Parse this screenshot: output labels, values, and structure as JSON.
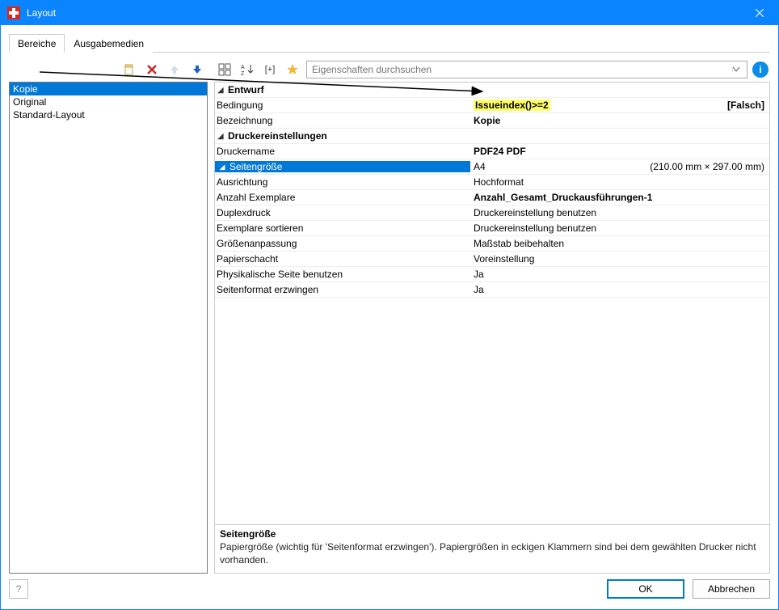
{
  "window": {
    "title": "Layout",
    "close_label": "×"
  },
  "tabs": [
    {
      "id": "bereiche",
      "label": "Bereiche",
      "active": true
    },
    {
      "id": "ausgabemedien",
      "label": "Ausgabemedien",
      "active": false
    }
  ],
  "left_toolbar": {
    "new_icon": "new",
    "delete_icon": "delete",
    "up_icon": "up",
    "down_icon": "down"
  },
  "regions": [
    {
      "label": "Kopie",
      "selected": true
    },
    {
      "label": "Original",
      "selected": false
    },
    {
      "label": "Standard-Layout",
      "selected": false
    }
  ],
  "prop_toolbar": {
    "categorized_icon": "categorized",
    "sort_icon": "sort-az",
    "expand_icon": "[+]",
    "fav_icon": "star",
    "search_placeholder": "Eigenschaften durchsuchen",
    "info_icon": "i"
  },
  "property_groups": [
    {
      "label": "Entwurf",
      "rows": [
        {
          "name": "Bedingung",
          "value": "Issueindex()>=2",
          "highlight": true,
          "extra": "[Falsch]"
        },
        {
          "name": "Bezeichnung",
          "value": "Kopie",
          "bold": true
        }
      ]
    },
    {
      "label": "Druckereinstellungen",
      "rows": [
        {
          "name": "Druckername",
          "value": "PDF24 PDF",
          "bold": true
        },
        {
          "name": "Seitengröße",
          "value": "A4",
          "extra": "(210.00 mm × 297.00 mm)",
          "selected": true,
          "expandable": true,
          "children": [
            {
              "name": "Ausrichtung",
              "value": "Hochformat"
            }
          ]
        },
        {
          "name": "Anzahl Exemplare",
          "value": "Anzahl_Gesamt_Druckausführungen-1",
          "bold": true
        },
        {
          "name": "Duplexdruck",
          "value": "Druckereinstellung benutzen"
        },
        {
          "name": "Exemplare sortieren",
          "value": "Druckereinstellung benutzen"
        },
        {
          "name": "Größenanpassung",
          "value": "Maßstab beibehalten"
        },
        {
          "name": "Papierschacht",
          "value": "Voreinstellung"
        },
        {
          "name": "Physikalische Seite benutzen",
          "value": "Ja"
        },
        {
          "name": "Seitenformat erzwingen",
          "value": "Ja"
        }
      ]
    }
  ],
  "description": {
    "title": "Seitengröße",
    "text": "Papiergröße (wichtig für 'Seitenformat erzwingen'). Papiergrößen in eckigen Klammern sind bei dem gewählten Drucker nicht vorhanden."
  },
  "footer": {
    "help": "?",
    "ok": "OK",
    "cancel": "Abbrechen"
  }
}
